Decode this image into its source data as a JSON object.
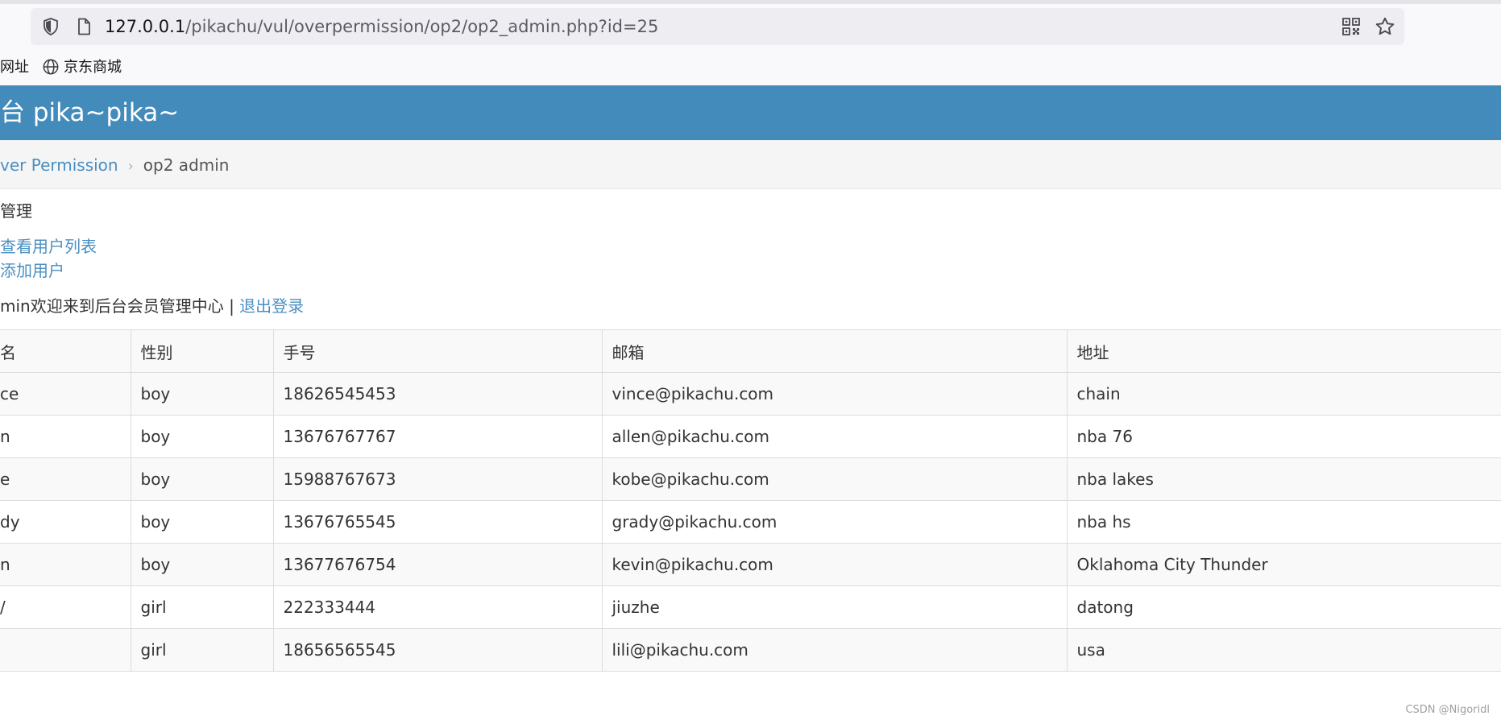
{
  "browser": {
    "url_host": "127.0.0.1",
    "url_path": "/pikachu/vul/overpermission/op2/op2_admin.php?id=25",
    "bookmarks": [
      {
        "label": "网址",
        "icon": "none"
      },
      {
        "label": "京东商城",
        "icon": "globe-icon"
      }
    ]
  },
  "header": {
    "title": "台 pika~pika~",
    "background_color": "#428bba"
  },
  "breadcrumb": {
    "parent": "ver Permission",
    "separator": "›",
    "current": "op2 admin"
  },
  "content": {
    "section_title": "管理",
    "links": [
      "查看用户列表",
      "添加用户"
    ],
    "welcome_text": "min欢迎来到后台会员管理中心 | ",
    "logout_label": "退出登录"
  },
  "table": {
    "headers": [
      "名",
      "性别",
      "手号",
      "邮箱",
      "地址"
    ],
    "rows": [
      [
        "ce",
        "boy",
        "18626545453",
        "vince@pikachu.com",
        "chain"
      ],
      [
        "n",
        "boy",
        "13676767767",
        "allen@pikachu.com",
        "nba 76"
      ],
      [
        "e",
        "boy",
        "15988767673",
        "kobe@pikachu.com",
        "nba lakes"
      ],
      [
        "dy",
        "boy",
        "13676765545",
        "grady@pikachu.com",
        "nba hs"
      ],
      [
        "n",
        "boy",
        "13677676754",
        "kevin@pikachu.com",
        "Oklahoma City Thunder"
      ],
      [
        "/",
        "girl",
        "222333444",
        "jiuzhe",
        "datong"
      ],
      [
        "",
        "girl",
        "18656565545",
        "lili@pikachu.com",
        "usa"
      ]
    ]
  },
  "watermark": "CSDN @Nigoridl",
  "colors": {
    "link": "#4a8fc2",
    "header": "#428bba",
    "row_stripe": "#f9f9f9"
  }
}
